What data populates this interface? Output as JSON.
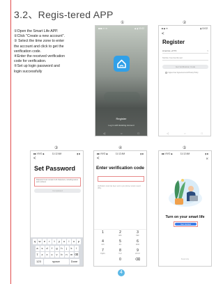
{
  "section_title": "3.2、Regis-tered APP",
  "steps": [
    "①Open the Smart Life APP.",
    "②Click \"Create a new account\".",
    "③ Select the time zone to enter",
    " the account and click to get the",
    "verification code.",
    "④Enter the received verification",
    " code for verification.",
    "⑤Set up login password and",
    "login successfully"
  ],
  "markers": [
    "①",
    "②",
    "③",
    "④",
    "⑤"
  ],
  "badge": "4",
  "screen1": {
    "status_left": "■■■ ☀ ✉",
    "status_right": "◆ ▮ 10:22",
    "register": "Register",
    "login": "Log in with Existing Account",
    "nav": [
      "◁",
      "○",
      "□"
    ]
  },
  "screen2": {
    "status_left": "■ ◆ ✉",
    "status_right": "▮ 10:22",
    "back": "<",
    "title": "Register",
    "country": "America +1774",
    "country_arrow": ">",
    "field": "Mobile Number/Email",
    "button": "Get Verification Code",
    "agree": "I Agree User Agreement and Privacy Policy",
    "nav": [
      "◁",
      "○",
      "□"
    ]
  },
  "screen3": {
    "status_left": "■■ VIVO ◆",
    "status_center": "11:12 AM",
    "status_right": "▮ ■",
    "back": "<",
    "title": "Set Password",
    "hint": "Password must contain 6-20 characters, including letters and numbers",
    "button": "Completed",
    "kb_rows": [
      [
        "q",
        "w",
        "e",
        "r",
        "t",
        "y",
        "u",
        "i",
        "o",
        "p"
      ],
      [
        "a",
        "s",
        "d",
        "f",
        "g",
        "h",
        "j",
        "k",
        "l"
      ],
      [
        "⇧",
        "z",
        "x",
        "c",
        "v",
        "b",
        "n",
        "m",
        "⌫"
      ],
      [
        "123",
        "space",
        "Done"
      ]
    ]
  },
  "screen4": {
    "status_left": "■■ VIVO ◆",
    "status_center": "11:12 AM",
    "status_right": "▮ ■",
    "back": "<",
    "title": "Enter verification code",
    "sub": "Verification code has been sent to your phone/ email, resend (55s)",
    "keys": [
      {
        "n": "1",
        "l": ""
      },
      {
        "n": "2",
        "l": "ABC"
      },
      {
        "n": "3",
        "l": "DEF"
      },
      {
        "n": "4",
        "l": "GHI"
      },
      {
        "n": "5",
        "l": "JKL"
      },
      {
        "n": "6",
        "l": "MNO"
      },
      {
        "n": "7",
        "l": "PQRS"
      },
      {
        "n": "8",
        "l": "TUV"
      },
      {
        "n": "9",
        "l": "WXYZ"
      },
      {
        "n": "",
        "l": ""
      },
      {
        "n": "0",
        "l": ""
      },
      {
        "n": "⌫",
        "l": ""
      }
    ]
  },
  "screen5": {
    "status_left": "■■ VIVO ◆",
    "status_center": "11:12 AM",
    "status_right": "▮ ■",
    "close": "×",
    "heading": "Turn on your smart life",
    "button": "Get started",
    "footer": "Smart Life"
  },
  "colors": {
    "accent_red": "#e24a4a",
    "app_blue": "#31a0e8",
    "button_blue": "#3c7de8"
  }
}
